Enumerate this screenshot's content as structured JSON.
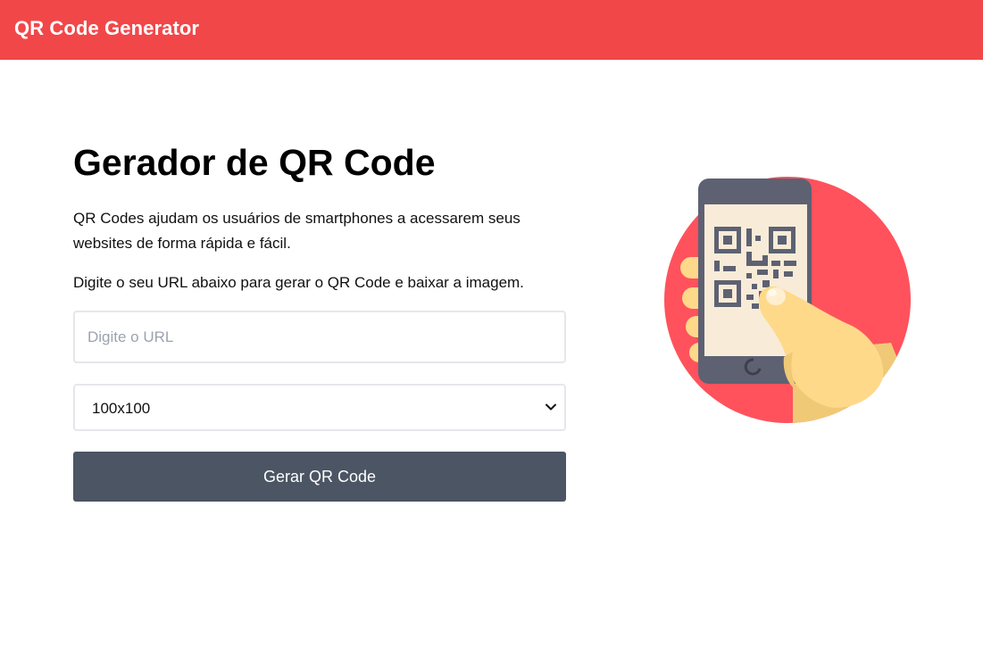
{
  "header": {
    "brand": "QR Code Generator"
  },
  "main": {
    "title": "Gerador de QR Code",
    "intro": "QR Codes ajudam os usuários de smartphones a acessarem seus websites de forma rápida e fácil.",
    "instructions": "Digite o seu URL abaixo para gerar o QR Code e baixar a imagem.",
    "url_input": {
      "value": "",
      "placeholder": "Digite o URL"
    },
    "size_select": {
      "selected": "100x100"
    },
    "generate_button": "Gerar QR Code"
  },
  "illustration": {
    "icon": "hand-holding-phone-qr-icon"
  },
  "colors": {
    "header_bg": "#f14749",
    "button_bg": "#4b5563",
    "circle": "#ff525d",
    "phone": "#5e6172",
    "screen": "#f8ecd8",
    "hand": "#ffd98a"
  }
}
